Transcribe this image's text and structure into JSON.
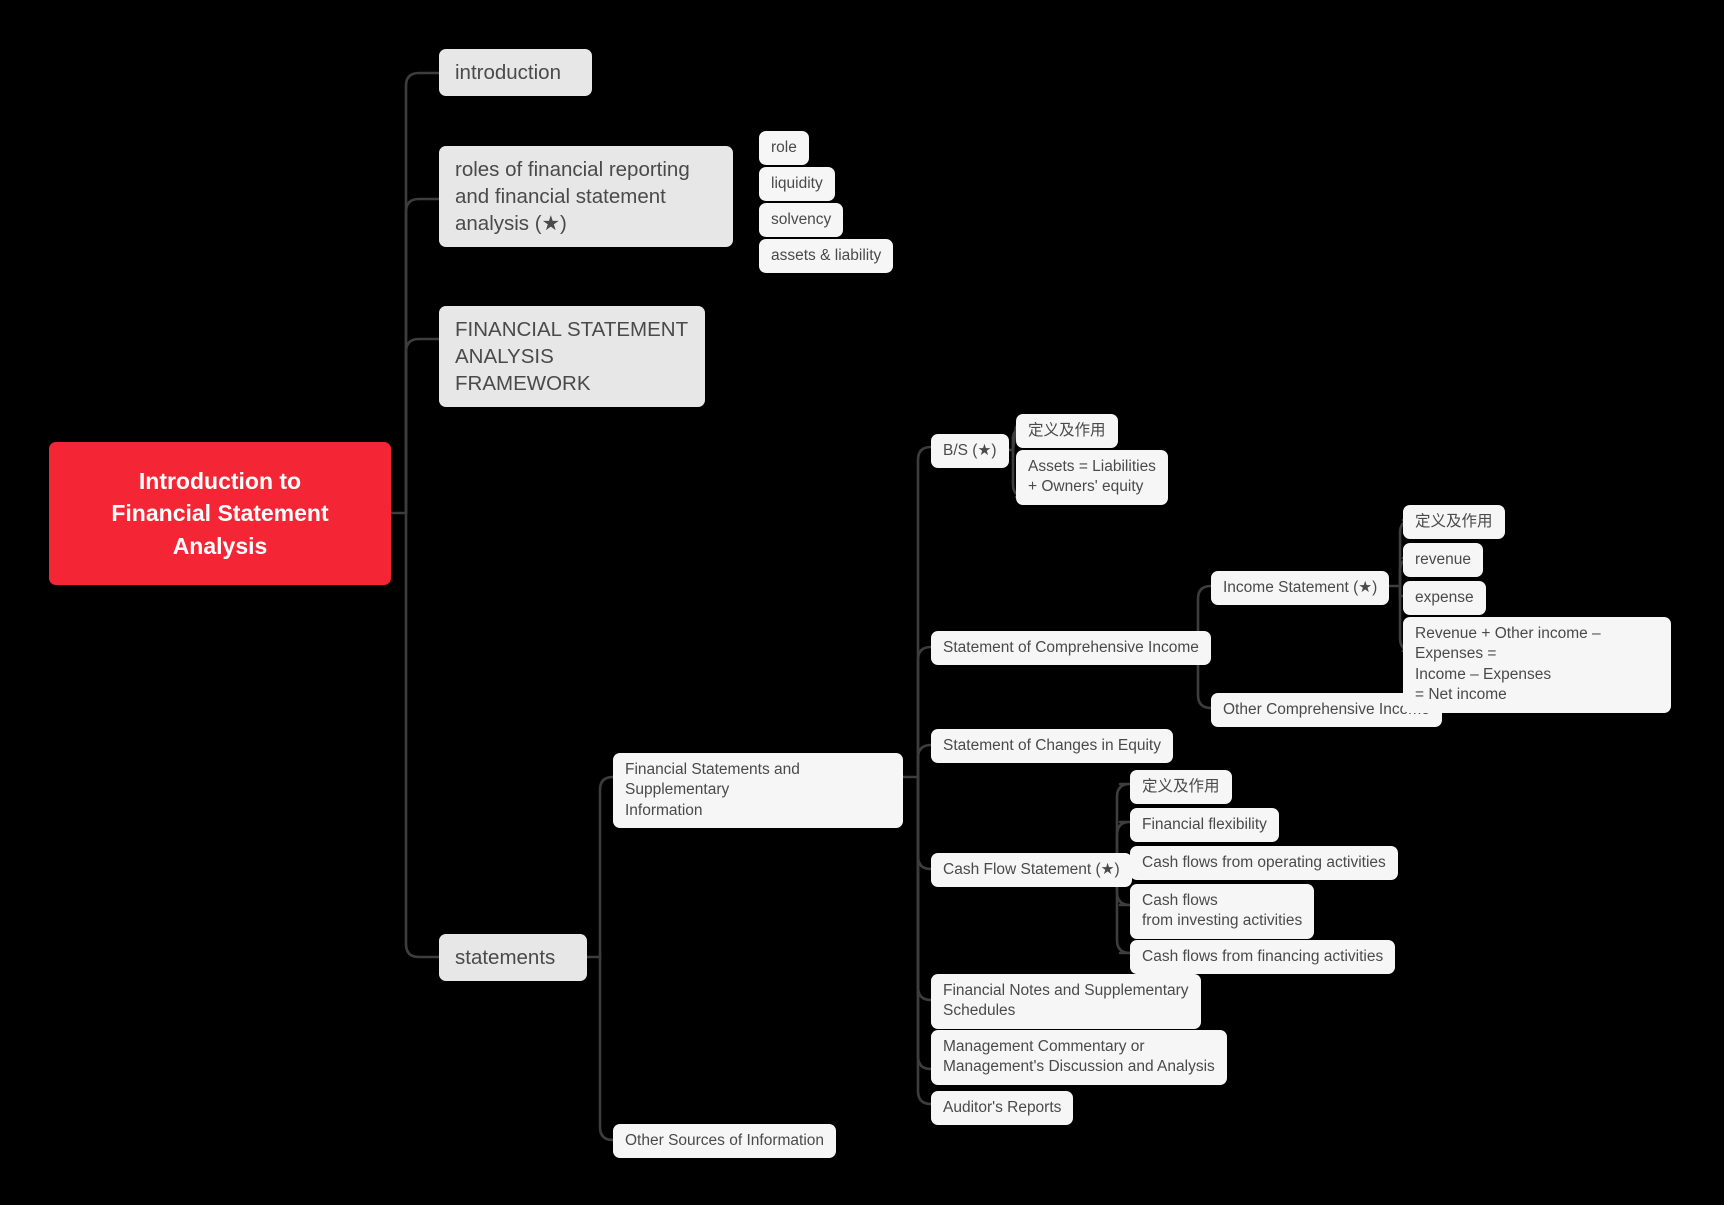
{
  "title": "Introduction to Financial Statement Analysis",
  "theme": {
    "background": "#000000",
    "root_fill": "#f42534",
    "root_text": "#ffffff",
    "level2_fill": "#e7e7e7",
    "leaf_fill": "#f6f6f6",
    "text": "#4a4a4a",
    "link": "#3d3d3d"
  },
  "root": {
    "label": "Introduction to\nFinancial Statement\nAnalysis"
  },
  "branches": [
    {
      "label": "introduction",
      "children": []
    },
    {
      "label": "roles of financial reporting\nand financial statement\nanalysis (★)",
      "children": [
        {
          "label": "role"
        },
        {
          "label": "liquidity"
        },
        {
          "label": "solvency"
        },
        {
          "label": "assets & liability"
        }
      ]
    },
    {
      "label": "FINANCIAL STATEMENT\nANALYSIS FRAMEWORK",
      "children": []
    },
    {
      "label": "statements",
      "children": [
        {
          "label": "Financial Statements and Supplementary\nInformation",
          "children": [
            {
              "label": "B/S (★)",
              "children": [
                {
                  "label": "定义及作用"
                },
                {
                  "label": "Assets = Liabilities\n+ Owners' equity"
                }
              ]
            },
            {
              "label": "Statement of Comprehensive Income",
              "children": [
                {
                  "label": "Income Statement (★)",
                  "children": [
                    {
                      "label": "定义及作用"
                    },
                    {
                      "label": "revenue"
                    },
                    {
                      "label": "expense"
                    },
                    {
                      "label": " Revenue + Other income – Expenses =\nIncome – Expenses\n= Net income"
                    }
                  ]
                },
                {
                  "label": "Other Comprehensive Income"
                }
              ]
            },
            {
              "label": "Statement of Changes in Equity"
            },
            {
              "label": "Cash Flow Statement (★)",
              "children": [
                {
                  "label": "定义及作用"
                },
                {
                  "label": "Financial flexibility"
                },
                {
                  "label": "Cash flows from operating activities"
                },
                {
                  "label": "Cash flows\nfrom investing activities"
                },
                {
                  "label": " Cash flows from financing activities"
                }
              ]
            },
            {
              "label": "Financial Notes and Supplementary\nSchedules"
            },
            {
              "label": "Management Commentary or\nManagement's Discussion and Analysis"
            },
            {
              "label": "Auditor's Reports"
            }
          ]
        },
        {
          "label": "Other Sources of Information"
        }
      ]
    }
  ]
}
